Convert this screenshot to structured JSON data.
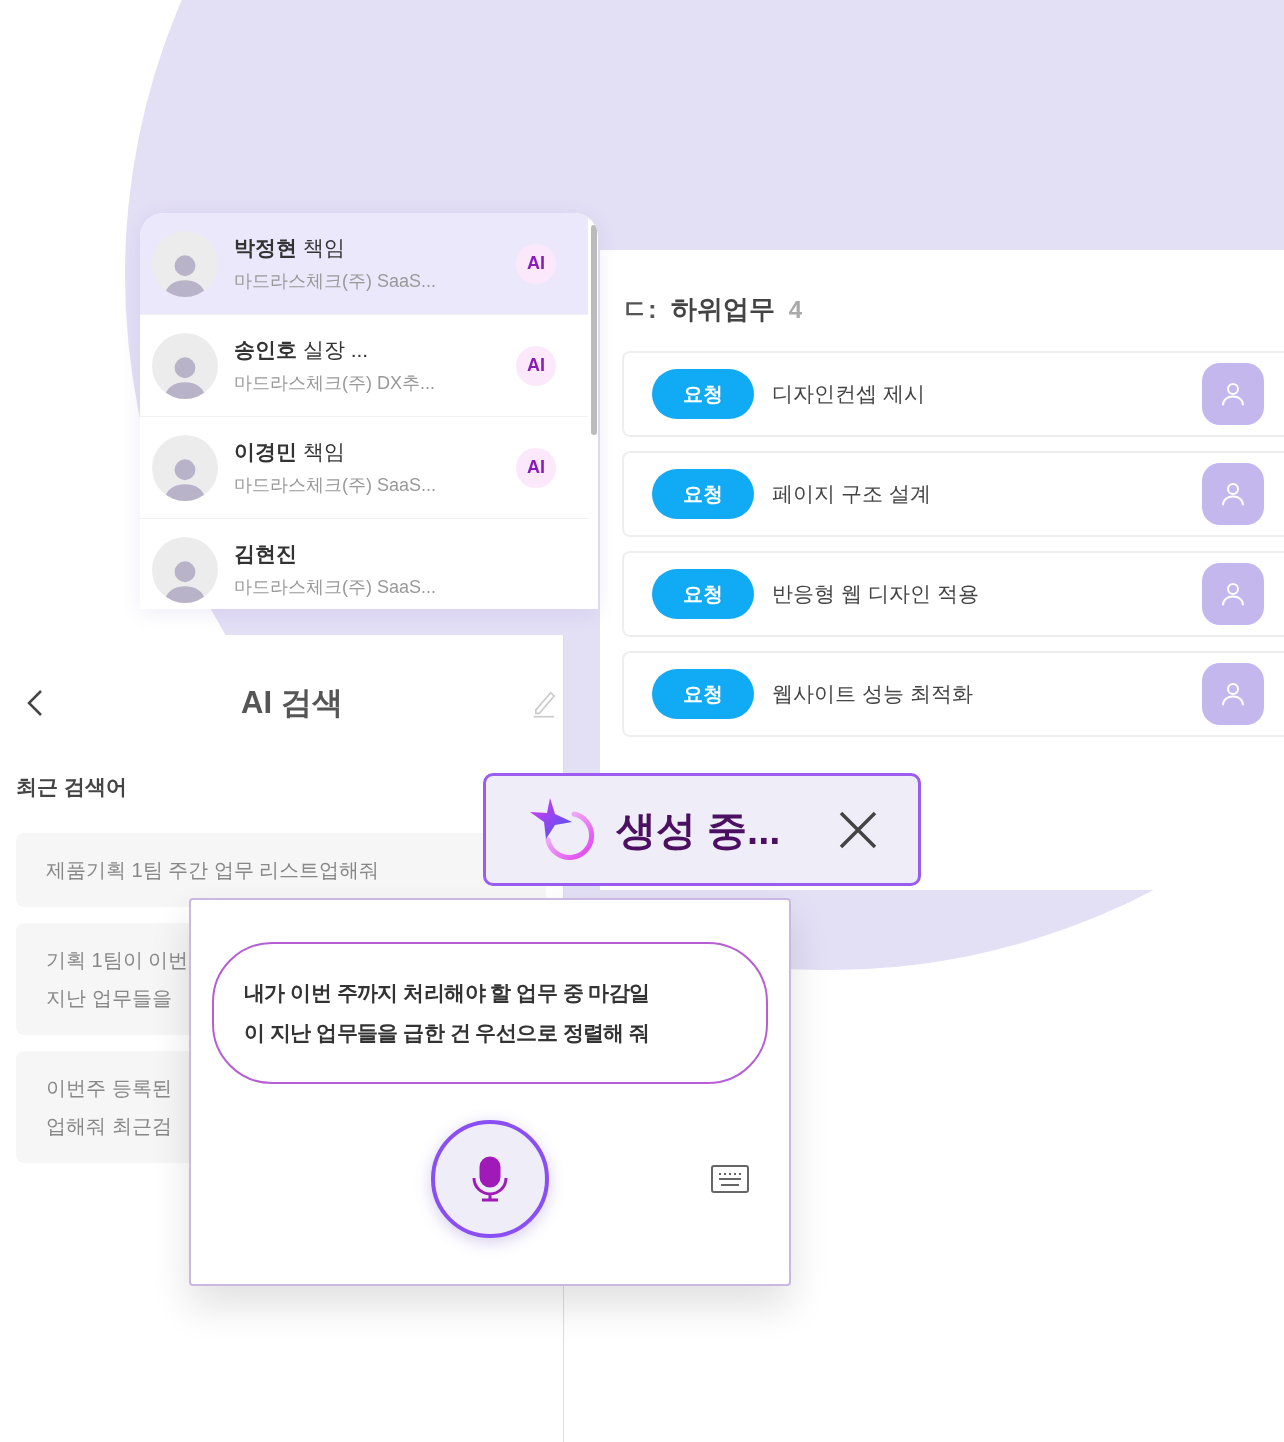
{
  "contacts": [
    {
      "name": "박정현",
      "title": "책임",
      "company": "마드라스체크(주) SaaS...",
      "badge": "AI",
      "selected": true
    },
    {
      "name": "송인호",
      "title": "실장 ...",
      "company": "마드라스체크(주) DX추...",
      "badge": "AI",
      "selected": false
    },
    {
      "name": "이경민",
      "title": "책임",
      "company": "마드라스체크(주) SaaS...",
      "badge": "AI",
      "selected": false
    },
    {
      "name": "김현진",
      "company": "마드라스체크(주) SaaS...",
      "selected": false
    }
  ],
  "subtasks": {
    "prefix": "ㄷ:",
    "title": "하위업무",
    "count": "4",
    "items": [
      {
        "status": "요청",
        "title": "디자인컨셉 제시"
      },
      {
        "status": "요청",
        "title": "페이지 구조 설계"
      },
      {
        "status": "요청",
        "title": "반응형 웹 디자인 적용"
      },
      {
        "status": "요청",
        "title": "웹사이트 성능 최적화"
      }
    ]
  },
  "ai_search": {
    "title": "AI 검색",
    "recent_label": "최근 검색어",
    "recent": [
      {
        "lines": [
          "제품기획 1팀 주간 업무 리스트업해줘"
        ]
      },
      {
        "lines": [
          "기획 1팀이 이번",
          "지난 업무들을"
        ]
      },
      {
        "lines": [
          "이번주 등록된",
          "업해줘 최근검"
        ]
      }
    ]
  },
  "toast": {
    "text": "생성 중..."
  },
  "voice": {
    "lines": [
      "내가 이번 주까지 처리해야 할 업무 중 마감일",
      "이 지난 업무들을 급한 건 우선으로 정렬해 줘"
    ]
  }
}
